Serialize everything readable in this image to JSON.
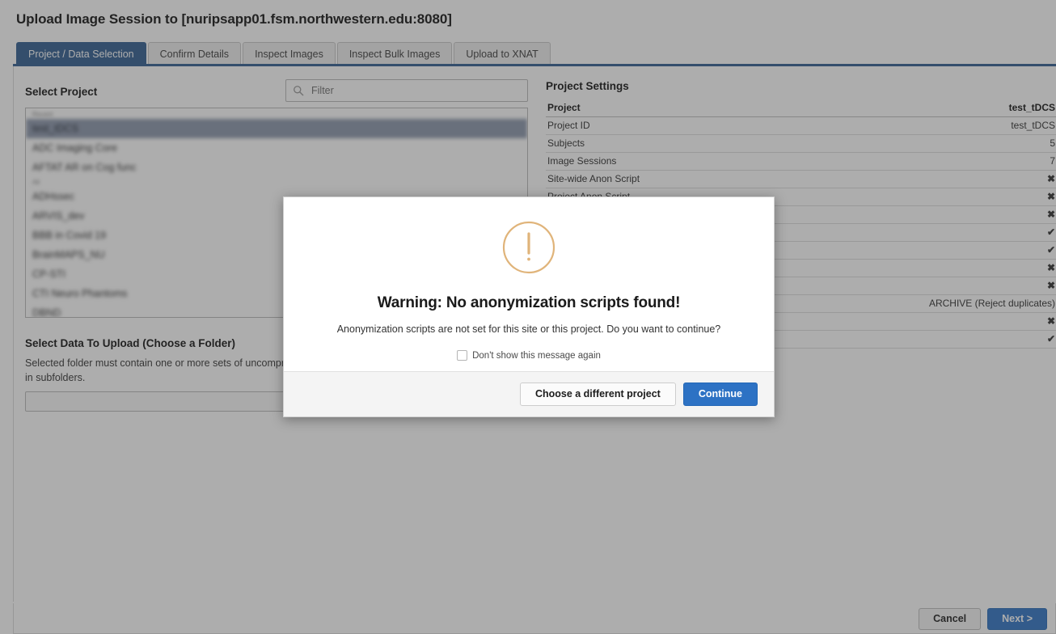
{
  "window": {
    "title": "Upload Image Session to [nuripsapp01.fsm.northwestern.edu:8080]"
  },
  "tabs": [
    {
      "label": "Project / Data Selection",
      "active": true
    },
    {
      "label": "Confirm Details",
      "active": false
    },
    {
      "label": "Inspect Images",
      "active": false
    },
    {
      "label": "Inspect Bulk Images",
      "active": false
    },
    {
      "label": "Upload to XNAT",
      "active": false
    }
  ],
  "left_panel": {
    "select_project_label": "Select Project",
    "filter_placeholder": "Filter",
    "filter_value": "",
    "project_groups": [
      {
        "group_label": "Recent",
        "items": [
          {
            "label": "test_tDCS",
            "selected": true
          },
          {
            "label": "ADC Imaging Core",
            "selected": false
          },
          {
            "label": "AFTAT AR on Cog func",
            "selected": false
          }
        ]
      },
      {
        "group_label": "All",
        "items": [
          {
            "label": "ADHssec",
            "selected": false
          },
          {
            "label": "ARVIS_dev",
            "selected": false
          },
          {
            "label": "BBB in Covid 19",
            "selected": false
          },
          {
            "label": "BrainMAPS_NU",
            "selected": false
          },
          {
            "label": "CP-STI",
            "selected": false
          },
          {
            "label": "CTI Neuro Phantoms",
            "selected": false
          },
          {
            "label": "DBND",
            "selected": false
          }
        ]
      }
    ],
    "select_data_label": "Select Data To Upload (Choose a Folder)",
    "select_data_desc": "Selected folder must contain one or more sets of uncompressed DICOM files in a flat directory structure or in subfolders.",
    "folder_value": ""
  },
  "project_settings": {
    "title": "Project Settings",
    "rows": [
      {
        "label": "Project",
        "value": "test_tDCS",
        "header": true
      },
      {
        "label": "Project ID",
        "value": "test_tDCS",
        "header": false
      },
      {
        "label": "Subjects",
        "value": "5",
        "header": false
      },
      {
        "label": "Image Sessions",
        "value": "7",
        "header": false
      },
      {
        "label": "Site-wide Anon Script",
        "value": "✖",
        "header": false
      },
      {
        "label": "Project Anon Script",
        "value": "✖",
        "header": false
      },
      {
        "label": "",
        "value": "✖",
        "header": false
      },
      {
        "label": "",
        "value": "✔",
        "header": false
      },
      {
        "label": "",
        "value": "✔",
        "header": false
      },
      {
        "label": "",
        "value": "✖",
        "header": false
      },
      {
        "label": "",
        "value": "✖",
        "header": false
      },
      {
        "label": "",
        "value": "ARCHIVE (Reject duplicates)",
        "header": false
      },
      {
        "label": "",
        "value": "✖",
        "header": false
      },
      {
        "label": "",
        "value": "✔",
        "header": false
      }
    ]
  },
  "bottom_bar": {
    "cancel_label": "Cancel",
    "next_label": "Next >"
  },
  "modal": {
    "icon": "warning-exclamation-circle-icon",
    "title": "Warning: No anonymization scripts found!",
    "message": "Anonymization scripts are not set for this site or this project. Do you want to continue?",
    "checkbox_label": "Don't show this message again",
    "checkbox_checked": false,
    "secondary_button": "Choose a different project",
    "primary_button": "Continue"
  },
  "colors": {
    "tab_active": "#2f5c8f",
    "primary_button": "#2d72c4",
    "selected_row": "#8b96ab",
    "warning_icon": "#e0b47a"
  }
}
